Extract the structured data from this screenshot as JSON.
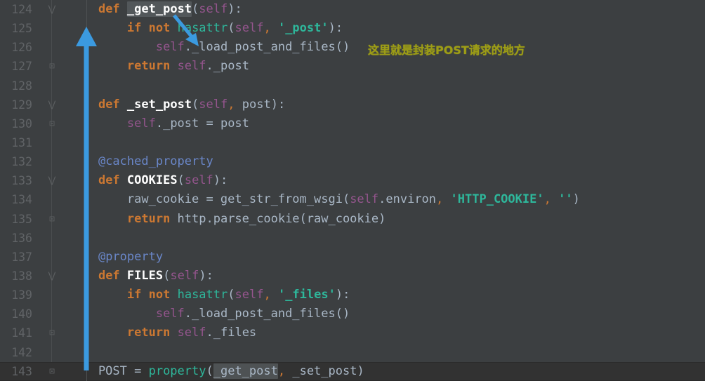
{
  "editor": {
    "theme": "darcula",
    "language": "python",
    "background_color": "#3c3f41",
    "current_line_color": "#323232",
    "gutter_number_color": "#606366",
    "default_text_color": "#a9b7c6"
  },
  "lines": [
    {
      "number": "124",
      "fold": "fold-collapse-down",
      "tokens": [
        {
          "t": "    ",
          "c": "plain"
        },
        {
          "t": "def",
          "c": "kw"
        },
        {
          "t": " ",
          "c": "plain"
        },
        {
          "t": "_get_post",
          "c": "fn",
          "hl": "occurrence"
        },
        {
          "t": "(",
          "c": "punct"
        },
        {
          "t": "self",
          "c": "self"
        },
        {
          "t": ")",
          "c": "punct"
        },
        {
          "t": ":",
          "c": "punct"
        }
      ]
    },
    {
      "number": "125",
      "fold": "",
      "tokens": [
        {
          "t": "        ",
          "c": "plain"
        },
        {
          "t": "if",
          "c": "kw"
        },
        {
          "t": " ",
          "c": "plain"
        },
        {
          "t": "not",
          "c": "kw"
        },
        {
          "t": " ",
          "c": "plain"
        },
        {
          "t": "hasattr",
          "c": "builtin"
        },
        {
          "t": "(",
          "c": "punct"
        },
        {
          "t": "self",
          "c": "self"
        },
        {
          "t": ",",
          "c": "comma"
        },
        {
          "t": " ",
          "c": "plain"
        },
        {
          "t": "'_post'",
          "c": "str"
        },
        {
          "t": ")",
          "c": "punct"
        },
        {
          "t": ":",
          "c": "punct"
        }
      ]
    },
    {
      "number": "126",
      "fold": "",
      "tokens": [
        {
          "t": "            ",
          "c": "plain"
        },
        {
          "t": "self",
          "c": "self"
        },
        {
          "t": "._load_post_and_files()",
          "c": "plain"
        }
      ]
    },
    {
      "number": "127",
      "fold": "fold-end-up",
      "tokens": [
        {
          "t": "        ",
          "c": "plain"
        },
        {
          "t": "return",
          "c": "kw"
        },
        {
          "t": " ",
          "c": "plain"
        },
        {
          "t": "self",
          "c": "self"
        },
        {
          "t": "._post",
          "c": "plain"
        }
      ]
    },
    {
      "number": "128",
      "fold": "",
      "tokens": []
    },
    {
      "number": "129",
      "fold": "fold-collapse-down",
      "tokens": [
        {
          "t": "    ",
          "c": "plain"
        },
        {
          "t": "def",
          "c": "kw"
        },
        {
          "t": " ",
          "c": "plain"
        },
        {
          "t": "_set_post",
          "c": "fn"
        },
        {
          "t": "(",
          "c": "punct"
        },
        {
          "t": "self",
          "c": "self"
        },
        {
          "t": ",",
          "c": "comma"
        },
        {
          "t": " post",
          "c": "param"
        },
        {
          "t": ")",
          "c": "punct"
        },
        {
          "t": ":",
          "c": "punct"
        }
      ]
    },
    {
      "number": "130",
      "fold": "fold-end-up",
      "tokens": [
        {
          "t": "        ",
          "c": "plain"
        },
        {
          "t": "self",
          "c": "self"
        },
        {
          "t": "._post = post",
          "c": "plain"
        }
      ]
    },
    {
      "number": "131",
      "fold": "",
      "tokens": []
    },
    {
      "number": "132",
      "fold": "",
      "tokens": [
        {
          "t": "    ",
          "c": "plain"
        },
        {
          "t": "@cached_property",
          "c": "deco"
        }
      ]
    },
    {
      "number": "133",
      "fold": "fold-collapse-down",
      "tokens": [
        {
          "t": "    ",
          "c": "plain"
        },
        {
          "t": "def",
          "c": "kw"
        },
        {
          "t": " ",
          "c": "plain"
        },
        {
          "t": "COOKIES",
          "c": "fn"
        },
        {
          "t": "(",
          "c": "punct"
        },
        {
          "t": "self",
          "c": "self"
        },
        {
          "t": ")",
          "c": "punct"
        },
        {
          "t": ":",
          "c": "punct"
        }
      ]
    },
    {
      "number": "134",
      "fold": "",
      "tokens": [
        {
          "t": "        raw_cookie = get_str_from_wsgi",
          "c": "plain"
        },
        {
          "t": "(",
          "c": "punct"
        },
        {
          "t": "self",
          "c": "self"
        },
        {
          "t": ".environ",
          "c": "plain"
        },
        {
          "t": ",",
          "c": "comma"
        },
        {
          "t": " ",
          "c": "plain"
        },
        {
          "t": "'HTTP_COOKIE'",
          "c": "str"
        },
        {
          "t": ",",
          "c": "comma"
        },
        {
          "t": " ",
          "c": "plain"
        },
        {
          "t": "''",
          "c": "str"
        },
        {
          "t": ")",
          "c": "punct"
        }
      ]
    },
    {
      "number": "135",
      "fold": "fold-end-up",
      "tokens": [
        {
          "t": "        ",
          "c": "plain"
        },
        {
          "t": "return",
          "c": "kw"
        },
        {
          "t": " http.parse_cookie(raw_cookie)",
          "c": "plain"
        }
      ]
    },
    {
      "number": "136",
      "fold": "",
      "tokens": []
    },
    {
      "number": "137",
      "fold": "",
      "tokens": [
        {
          "t": "    ",
          "c": "plain"
        },
        {
          "t": "@property",
          "c": "deco"
        }
      ]
    },
    {
      "number": "138",
      "fold": "fold-collapse-down",
      "tokens": [
        {
          "t": "    ",
          "c": "plain"
        },
        {
          "t": "def",
          "c": "kw"
        },
        {
          "t": " ",
          "c": "plain"
        },
        {
          "t": "FILES",
          "c": "fn"
        },
        {
          "t": "(",
          "c": "punct"
        },
        {
          "t": "self",
          "c": "self"
        },
        {
          "t": ")",
          "c": "punct"
        },
        {
          "t": ":",
          "c": "punct"
        }
      ]
    },
    {
      "number": "139",
      "fold": "",
      "tokens": [
        {
          "t": "        ",
          "c": "plain"
        },
        {
          "t": "if",
          "c": "kw"
        },
        {
          "t": " ",
          "c": "plain"
        },
        {
          "t": "not",
          "c": "kw"
        },
        {
          "t": " ",
          "c": "plain"
        },
        {
          "t": "hasattr",
          "c": "builtin"
        },
        {
          "t": "(",
          "c": "punct"
        },
        {
          "t": "self",
          "c": "self"
        },
        {
          "t": ",",
          "c": "comma"
        },
        {
          "t": " ",
          "c": "plain"
        },
        {
          "t": "'_files'",
          "c": "str"
        },
        {
          "t": ")",
          "c": "punct"
        },
        {
          "t": ":",
          "c": "punct"
        }
      ]
    },
    {
      "number": "140",
      "fold": "",
      "tokens": [
        {
          "t": "            ",
          "c": "plain"
        },
        {
          "t": "self",
          "c": "self"
        },
        {
          "t": "._load_post_and_files()",
          "c": "plain"
        }
      ]
    },
    {
      "number": "141",
      "fold": "fold-end-up",
      "tokens": [
        {
          "t": "        ",
          "c": "plain"
        },
        {
          "t": "return",
          "c": "kw"
        },
        {
          "t": " ",
          "c": "plain"
        },
        {
          "t": "self",
          "c": "self"
        },
        {
          "t": "._files",
          "c": "plain"
        }
      ]
    },
    {
      "number": "142",
      "fold": "",
      "tokens": []
    },
    {
      "number": "143",
      "fold": "fold-end-up",
      "current": true,
      "tokens": [
        {
          "t": "    POST = ",
          "c": "plain"
        },
        {
          "t": "property",
          "c": "builtin"
        },
        {
          "t": "(",
          "c": "punct"
        },
        {
          "t": "_get_post",
          "c": "plain",
          "hl": "selection"
        },
        {
          "t": ",",
          "c": "comma"
        },
        {
          "t": " _set_post",
          "c": "plain"
        },
        {
          "t": ")",
          "c": "punct"
        }
      ]
    }
  ],
  "annotations": {
    "comment_note": {
      "text": "这里就是封装POST请求的地方",
      "color": "#9d9d16"
    },
    "vertical_arrow": {
      "label": "vertical-blue-arrow",
      "color": "#3b9ae0",
      "points_from_line": "143",
      "points_to_line": "125"
    },
    "diagonal_arrow": {
      "label": "diagonal-blue-arrow",
      "color": "#3b9ae0",
      "points_from": "_get_post",
      "points_to": "self._load_post_and_files()"
    }
  }
}
